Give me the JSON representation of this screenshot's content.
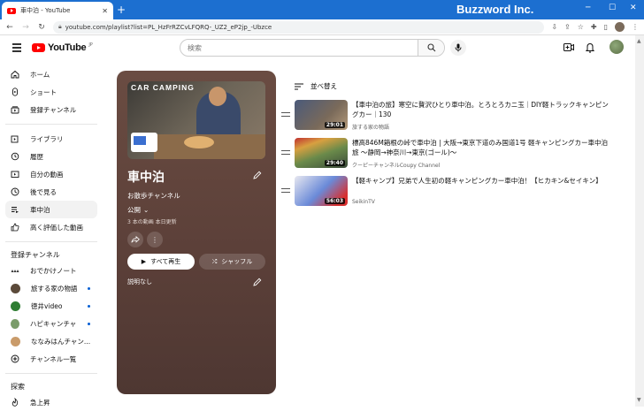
{
  "browser": {
    "tab_title": "車中泊 - YouTube",
    "url": "youtube.com/playlist?list=PL_HzFrRZCvLFQRQ-_UZ2_eP2jp_-Ubzce",
    "brand": "Buzzword Inc."
  },
  "header": {
    "logo_text": "YouTube",
    "logo_suffix": "JP",
    "search_placeholder": "検索"
  },
  "sidebar": {
    "main": [
      {
        "label": "ホーム",
        "icon": "home-icon"
      },
      {
        "label": "ショート",
        "icon": "shorts-icon"
      },
      {
        "label": "登録チャンネル",
        "icon": "subscriptions-icon"
      }
    ],
    "library": [
      {
        "label": "ライブラリ",
        "icon": "library-icon"
      },
      {
        "label": "履歴",
        "icon": "history-icon"
      },
      {
        "label": "自分の動画",
        "icon": "your-videos-icon"
      },
      {
        "label": "後で見る",
        "icon": "watch-later-icon"
      },
      {
        "label": "車中泊",
        "icon": "playlist-icon",
        "active": true
      },
      {
        "label": "高く評価した動画",
        "icon": "like-icon"
      }
    ],
    "subscriptions_heading": "登録チャンネル",
    "subscriptions": [
      {
        "label": "おでかけノート",
        "new": false
      },
      {
        "label": "旅する家の物語",
        "new": true
      },
      {
        "label": "徳井video",
        "new": true
      },
      {
        "label": "ハピキャンチャ...",
        "new": true
      },
      {
        "label": "ななみはんチャン...",
        "new": false
      },
      {
        "label": "チャンネル一覧",
        "new": false
      }
    ],
    "explore_heading": "探索",
    "explore": [
      {
        "label": "急上昇",
        "icon": "trending-icon"
      }
    ]
  },
  "playlist": {
    "cover_text": "CAR CAMPING",
    "title": "車中泊",
    "owner": "お散歩チャンネル",
    "visibility": "公開",
    "meta": "3 本の動画  本日更新",
    "play_all": "すべて再生",
    "shuffle": "シャッフル",
    "description": "説明なし"
  },
  "sort_label": "並べ替え",
  "videos": [
    {
      "title": "【車中泊の旅】寒空に贅沢ひとり車中泊。とろとろカニ玉｜DIY軽トラックキャンピングカー｜130",
      "channel": "旅する家の物語",
      "duration": "29:01"
    },
    {
      "title": "標高846M箱根の峠で車中泊 | 大阪→東京下道のみ国道1号 軽キャンピングカー車中泊旅 ～静岡→神奈川→東京(ゴール)～",
      "channel": "クーピーチャンネルCoupy Channel",
      "duration": "29:40"
    },
    {
      "title": "【軽キャンプ】兄弟で人生初の軽キャンピングカー車中泊！【ヒカキン&セイキン】",
      "channel": "SeikinTV",
      "duration": "56:03"
    }
  ]
}
